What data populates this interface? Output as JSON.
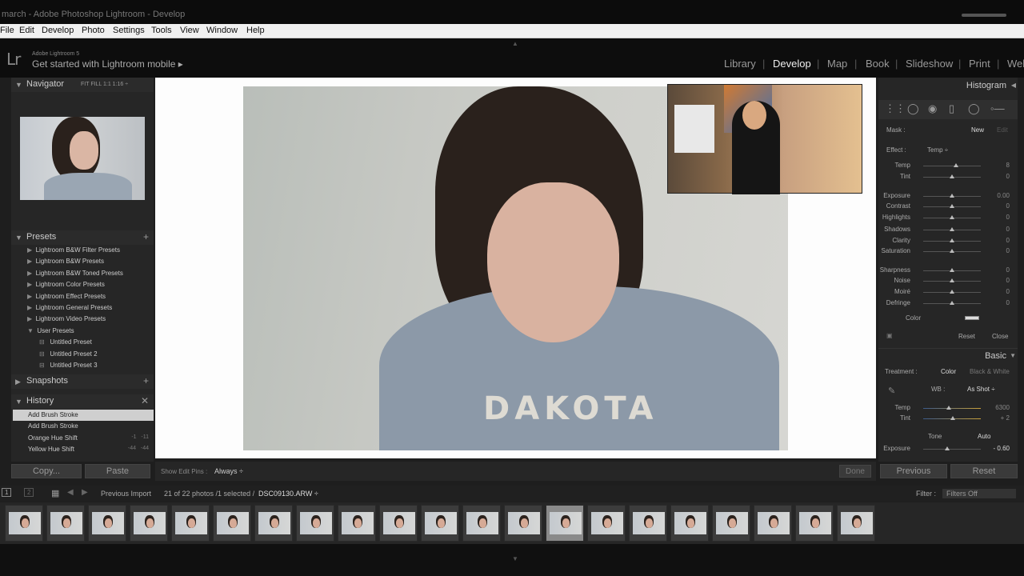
{
  "window": {
    "title": "march - Adobe Photoshop Lightroom - Develop"
  },
  "menu": [
    "File",
    "Edit",
    "Develop",
    "Photo",
    "Settings",
    "Tools",
    "View",
    "Window",
    "Help"
  ],
  "idplate": {
    "logo": "Lr",
    "product": "Adobe Lightroom 5",
    "mobile": "Get started with Lightroom mobile ▸"
  },
  "modules": [
    "Library",
    "Develop",
    "Map",
    "Book",
    "Slideshow",
    "Print",
    "Web"
  ],
  "active_module": "Develop",
  "left": {
    "navigator": {
      "title": "Navigator",
      "options": "FIT   FILL   1:1   1:16 ÷"
    },
    "presets": {
      "title": "Presets",
      "folders": [
        "Lightroom B&W Filter Presets",
        "Lightroom B&W Presets",
        "Lightroom B&W Toned Presets",
        "Lightroom Color Presets",
        "Lightroom Effect Presets",
        "Lightroom General Presets",
        "Lightroom Video Presets",
        "User Presets"
      ],
      "user_presets": [
        "Untitled Preset",
        "Untitled Preset 2",
        "Untitled Preset 3"
      ]
    },
    "snapshots": {
      "title": "Snapshots"
    },
    "history": {
      "title": "History",
      "items": [
        {
          "label": "Add Brush Stroke",
          "a": "",
          "b": ""
        },
        {
          "label": "Add Brush Stroke",
          "a": "",
          "b": ""
        },
        {
          "label": "Orange Hue Shift",
          "a": "-1",
          "b": "-11"
        },
        {
          "label": "Yellow Hue Shift",
          "a": "-44",
          "b": "-44"
        }
      ]
    },
    "copy_label": "Copy...",
    "paste_label": "Paste"
  },
  "canvas": {
    "hoodie_text": "DAKOTA"
  },
  "toolbar": {
    "show_edit_pins": "Show Edit Pins :",
    "pins_value": "Always ÷",
    "done": "Done"
  },
  "right": {
    "histogram": "Histogram",
    "mask_label": "Mask :",
    "mask_new": "New",
    "mask_edit": "Edit",
    "effect_label": "Effect :",
    "effect_value": "Temp ÷",
    "brush_sliders": [
      {
        "label": "Temp",
        "value": "8",
        "pos": 0.57
      },
      {
        "label": "Tint",
        "value": "0",
        "pos": 0.5
      },
      {
        "label": "Exposure",
        "value": "0.00",
        "pos": 0.5
      },
      {
        "label": "Contrast",
        "value": "0",
        "pos": 0.5
      },
      {
        "label": "Highlights",
        "value": "0",
        "pos": 0.5
      },
      {
        "label": "Shadows",
        "value": "0",
        "pos": 0.5
      },
      {
        "label": "Clarity",
        "value": "0",
        "pos": 0.5
      },
      {
        "label": "Saturation",
        "value": "0",
        "pos": 0.5
      },
      {
        "label": "Sharpness",
        "value": "0",
        "pos": 0.5
      },
      {
        "label": "Noise",
        "value": "0",
        "pos": 0.5
      },
      {
        "label": "Moiré",
        "value": "0",
        "pos": 0.5
      },
      {
        "label": "Defringe",
        "value": "0",
        "pos": 0.5
      }
    ],
    "color_label": "Color",
    "reset": "Reset",
    "close": "Close",
    "basic": "Basic",
    "treatment_label": "Treatment :",
    "treatment_color": "Color",
    "treatment_bw": "Black & White",
    "wb_label": "WB :",
    "wb_value": "As Shot ÷",
    "basic_sliders": [
      {
        "label": "Temp",
        "value": "6300",
        "pos": 0.45
      },
      {
        "label": "Tint",
        "value": "+ 2",
        "pos": 0.52
      }
    ],
    "tone_label": "Tone",
    "auto_label": "Auto",
    "basic_exposure": {
      "label": "Exposure",
      "value": "- 0.60",
      "pos": 0.42
    },
    "previous_btn": "Previous",
    "reset_btn": "Reset"
  },
  "filmbar": {
    "source": "Previous Import",
    "count": "21 of 22 photos /1 selected /",
    "filename": "DSC09130.ARW ÷",
    "filter_label": "Filter :",
    "filter_value": "Filters Off"
  },
  "filmstrip": {
    "count": 21,
    "selected": 13
  }
}
